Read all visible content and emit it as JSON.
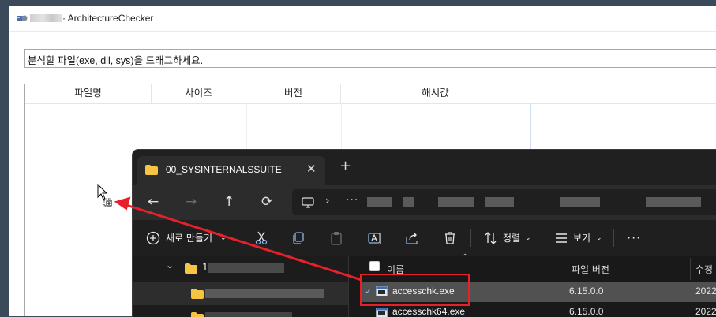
{
  "app": {
    "title": "· ArchitectureChecker",
    "drop_hint": "분석할 파일(exe, dll, sys)을 드래그하세요.",
    "columns": [
      "파일명",
      "사이즈",
      "버전",
      "해시값"
    ]
  },
  "explorer": {
    "tab_title": "00_SYSINTERNALSSUITE",
    "tab_close": "✕",
    "new_tab": "+",
    "nav": {
      "back": "←",
      "forward": "→",
      "up": "↑",
      "refresh": "⟳"
    },
    "address": {
      "separator": "›",
      "more": "···"
    },
    "toolbar": {
      "new_label": "새로 만들기",
      "sort_label": "정렬",
      "view_label": "보기",
      "more": "···"
    },
    "columns": {
      "name": "이름",
      "file_version": "파일 버전",
      "modified": "수정"
    },
    "tree": {
      "expand_glyph": "⌄",
      "item_prefix": "1"
    },
    "files": [
      {
        "name": "accesschk.exe",
        "version": "6.15.0.0",
        "date": "2022",
        "selected": true
      },
      {
        "name": "accesschk64.exe",
        "version": "6.15.0.0",
        "date": "2022",
        "selected": false
      }
    ]
  },
  "colors": {
    "highlight": "#e8202a",
    "folder": "#f5c542",
    "explorer_bg": "#1c1c1c"
  }
}
